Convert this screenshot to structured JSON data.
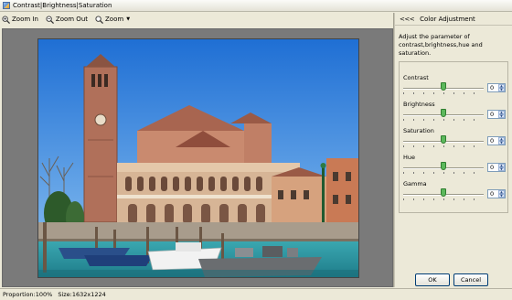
{
  "window": {
    "title": "Contrast|Brightness|Saturation"
  },
  "toolbar": {
    "zoom_in": "Zoom In",
    "zoom_out": "Zoom Out",
    "zoom": "Zoom"
  },
  "panel": {
    "collapse": "<<<",
    "title": "Color Adjustment",
    "description": "Adjust the parameter of contrast,brightness,hue and saturation.",
    "sliders": [
      {
        "label": "Contrast",
        "value": "0",
        "level": 0.5
      },
      {
        "label": "Brightness",
        "value": "0",
        "level": 0.5
      },
      {
        "label": "Saturation",
        "value": "0",
        "level": 0.5
      },
      {
        "label": "Hue",
        "value": "0",
        "level": 0.5
      },
      {
        "label": "Gamma",
        "value": "0",
        "level": 0.5
      }
    ],
    "ok": "OK",
    "cancel": "Cancel"
  },
  "status": {
    "proportion": "Proportion:100%",
    "size": "Size:1632x1224"
  },
  "colors": {
    "accent_thumb": "#5cb85c",
    "sky": "#3f8fe0"
  }
}
